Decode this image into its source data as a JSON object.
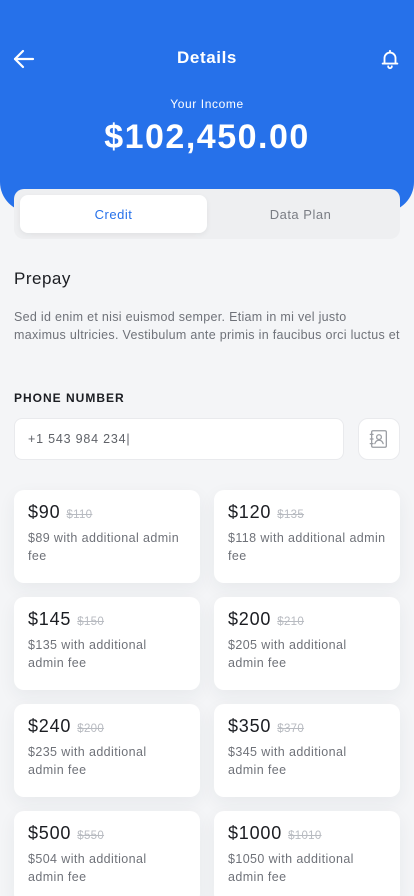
{
  "header": {
    "title": "Details",
    "income_label": "Your Income",
    "income_value": "$102,450.00"
  },
  "icons": {
    "back": "arrow-left-icon",
    "notifications": "bell-icon",
    "contacts": "contact-book-icon"
  },
  "tabs": [
    {
      "label": "Credit",
      "active": true
    },
    {
      "label": "Data Plan",
      "active": false
    }
  ],
  "section": {
    "title": "Prepay",
    "description": "Sed id enim et nisi euismod semper. Etiam in mi vel justo maximus ultricies. Vestibulum ante primis in faucibus orci luctus et"
  },
  "phone": {
    "label": "PHONE NUMBER",
    "value": "+1 543 984 234|"
  },
  "plans": [
    {
      "price": "$90",
      "old_price": "$110",
      "note": "$89 with additional admin fee"
    },
    {
      "price": "$120",
      "old_price": "$135",
      "note": "$118 with additional admin fee"
    },
    {
      "price": "$145",
      "old_price": "$150",
      "note": "$135 with additional admin fee"
    },
    {
      "price": "$200",
      "old_price": "$210",
      "note": "$205 with additional admin fee"
    },
    {
      "price": "$240",
      "old_price": "$200",
      "note": "$235 with additional admin fee"
    },
    {
      "price": "$350",
      "old_price": "$370",
      "note": "$345 with additional admin fee"
    },
    {
      "price": "$500",
      "old_price": "$550",
      "note": "$504 with additional admin fee"
    },
    {
      "price": "$1000",
      "old_price": "$1010",
      "note": "$1050 with additional admin fee"
    }
  ],
  "colors": {
    "primary": "#2671EA",
    "background": "#F4F5F7",
    "card": "#FFFFFF",
    "muted_text": "#6F7279",
    "strike_text": "#B8BBC1"
  }
}
